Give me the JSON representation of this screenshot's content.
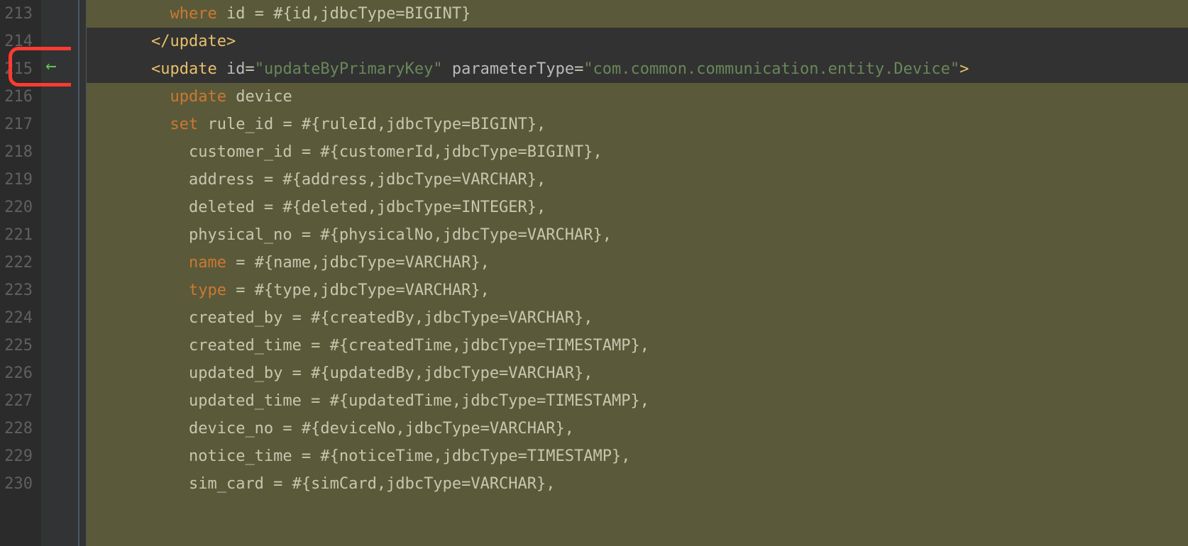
{
  "gutter": {
    "start": 213,
    "count": 18
  },
  "arrow": {
    "glyph": "←"
  },
  "lines": {
    "l213": {
      "indent": "      ",
      "kw": "where",
      "rest": " id = #{id,jdbcType=BIGINT}"
    },
    "l214": {
      "indent": "    ",
      "closeTag": "</update>"
    },
    "l215": {
      "indent": "    ",
      "openLt": "<",
      "tag": "update",
      "sp1": " ",
      "attr1": "id",
      "eq1": "=",
      "val1": "\"updateByPrimaryKey\"",
      "sp2": " ",
      "attr2": "parameterType",
      "eq2": "=",
      "val2": "\"com.common.communication.entity.Device\"",
      "gt": ">"
    },
    "l216": {
      "indent": "      ",
      "kw": "update",
      "rest": " device"
    },
    "l217": {
      "indent": "      ",
      "kw": "set",
      "rest": " rule_id = #{ruleId,jdbcType=BIGINT},"
    },
    "l218": {
      "indent": "        ",
      "text": "customer_id = #{customerId,jdbcType=BIGINT},"
    },
    "l219": {
      "indent": "        ",
      "text": "address = #{address,jdbcType=VARCHAR},"
    },
    "l220": {
      "indent": "        ",
      "text": "deleted = #{deleted,jdbcType=INTEGER},"
    },
    "l221": {
      "indent": "        ",
      "text": "physical_no = #{physicalNo,jdbcType=VARCHAR},"
    },
    "l222": {
      "indent": "        ",
      "kw": "name",
      "rest": " = #{name,jdbcType=VARCHAR},"
    },
    "l223": {
      "indent": "        ",
      "kw": "type",
      "rest": " = #{type,jdbcType=VARCHAR},"
    },
    "l224": {
      "indent": "        ",
      "text": "created_by = #{createdBy,jdbcType=VARCHAR},"
    },
    "l225": {
      "indent": "        ",
      "text": "created_time = #{createdTime,jdbcType=TIMESTAMP},"
    },
    "l226": {
      "indent": "        ",
      "text": "updated_by = #{updatedBy,jdbcType=VARCHAR},"
    },
    "l227": {
      "indent": "        ",
      "text": "updated_time = #{updatedTime,jdbcType=TIMESTAMP},"
    },
    "l228": {
      "indent": "        ",
      "text": "device_no = #{deviceNo,jdbcType=VARCHAR},"
    },
    "l229": {
      "indent": "        ",
      "text": "notice_time = #{noticeTime,jdbcType=TIMESTAMP},"
    },
    "l230": {
      "indent": "        ",
      "text": "sim_card = #{simCard,jdbcType=VARCHAR},"
    }
  }
}
